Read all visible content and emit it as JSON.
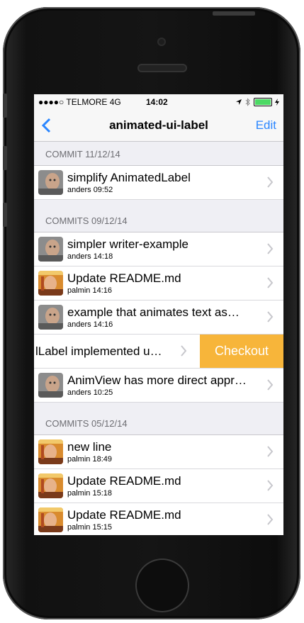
{
  "status": {
    "carrier": "●●●●○ TELMORE  4G",
    "time": "14:02"
  },
  "nav": {
    "title": "animated-ui-label",
    "edit": "Edit"
  },
  "sections": [
    {
      "header": "COMMIT 11/12/14",
      "rows": [
        {
          "title": "simplify AnimatedLabel",
          "meta": "anders 09:52",
          "avatar": "anders"
        }
      ]
    },
    {
      "header": "COMMITS 09/12/14",
      "rows": [
        {
          "title": "simpler writer-example",
          "meta": "anders 14:18",
          "avatar": "anders"
        },
        {
          "title": "Update README.md",
          "meta": "palmin 14:16",
          "avatar": "palmin"
        },
        {
          "title": "example that animates text as…",
          "meta": "anders 14:16",
          "avatar": "anders"
        },
        {
          "title": "lLabel implemented u…",
          "meta": "",
          "avatar": "",
          "swiped": true,
          "action": "Checkout"
        },
        {
          "title": "AnimView has more direct appr…",
          "meta": "anders 10:25",
          "avatar": "anders"
        }
      ]
    },
    {
      "header": "COMMITS 05/12/14",
      "rows": [
        {
          "title": "new line",
          "meta": "palmin 18:49",
          "avatar": "palmin"
        },
        {
          "title": "Update README.md",
          "meta": "palmin 15:18",
          "avatar": "palmin"
        },
        {
          "title": "Update README.md",
          "meta": "palmin 15:15",
          "avatar": "palmin"
        }
      ]
    }
  ],
  "colors": {
    "accent": "#2a86ff",
    "checkout": "#f7b53a",
    "background": "#efeff4"
  }
}
